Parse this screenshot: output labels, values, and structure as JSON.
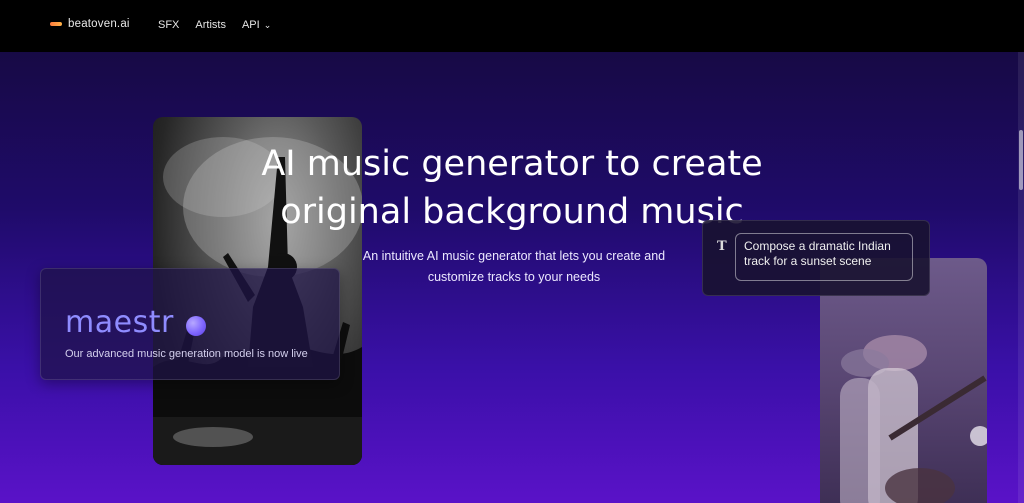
{
  "nav": {
    "logo_text": "beatoven.ai",
    "items": [
      "SFX",
      "Artists",
      "API"
    ]
  },
  "hero": {
    "headline_line1": "AI music generator to create",
    "headline_line2": "original background music",
    "subtitle_line1": "An intuitive AI music generator that lets you create and",
    "subtitle_line2": "customize tracks to your needs"
  },
  "maestro_card": {
    "title": "maestr",
    "description": "Our advanced music generation model is now live"
  },
  "prompt_card": {
    "icon_text": "T",
    "prompt_text": "Compose a dramatic Indian track for a sunset scene"
  },
  "colors": {
    "accent": "#8f8cff",
    "logo_accent": "#ff7a3d",
    "hero_top": "#170a45",
    "hero_bottom": "#5a12c8"
  }
}
